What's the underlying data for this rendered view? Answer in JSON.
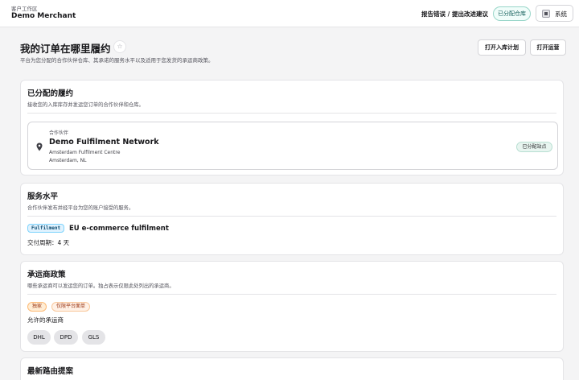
{
  "topbar": {
    "org_label": "客户工作区",
    "org_name": "Demo Merchant",
    "report_link": "报告错误 / 提出改进建议",
    "assigned_pill": "已分配仓库",
    "system_label": "系统",
    "system_icon": "monitor-icon"
  },
  "header": {
    "title": "我的订单在哪里履约",
    "star_glyph": "☆",
    "subtitle": "平台为您分配的合作伙伴仓库、其承诺的服务水平以及适用于您发货的承运商政策。",
    "btn_inbound": "打开入库计划",
    "btn_ops": "打开运营"
  },
  "assigned": {
    "title": "已分配的履约",
    "desc": "接收您的入库库存并发运您订单的合作伙伴和仓库。",
    "partner_kicker": "合作伙伴",
    "partner_name": "Demo Fulfilment Network",
    "site": "Amsterdam Fulfilment Centre",
    "location": "Amsterdam, NL",
    "badge": "已分配站点",
    "pin_icon": "map-pin-icon"
  },
  "service": {
    "title": "服务水平",
    "desc": "合作伙伴发布并经平台为您的账户接受的服务。",
    "tag": "Fulfilment",
    "name": "EU e-commerce fulfilment",
    "delivery": "交付周期：4 天"
  },
  "carrier": {
    "title": "承运商政策",
    "desc": "哪些承运商可以发运您的订单。独占表示仅限此处列出的承运商。",
    "tag_exclusive": "独家",
    "tag_platform": "仅限平台面单",
    "allowed_label": "允许的承运商",
    "carriers": [
      "DHL",
      "DPD",
      "GLS"
    ]
  },
  "routing": {
    "title": "最新路由提案"
  },
  "colors": {
    "accent_teal": "#115e59",
    "fulfil_tag": "#0c4a6e",
    "exclusive_tag": "#9a3412"
  }
}
